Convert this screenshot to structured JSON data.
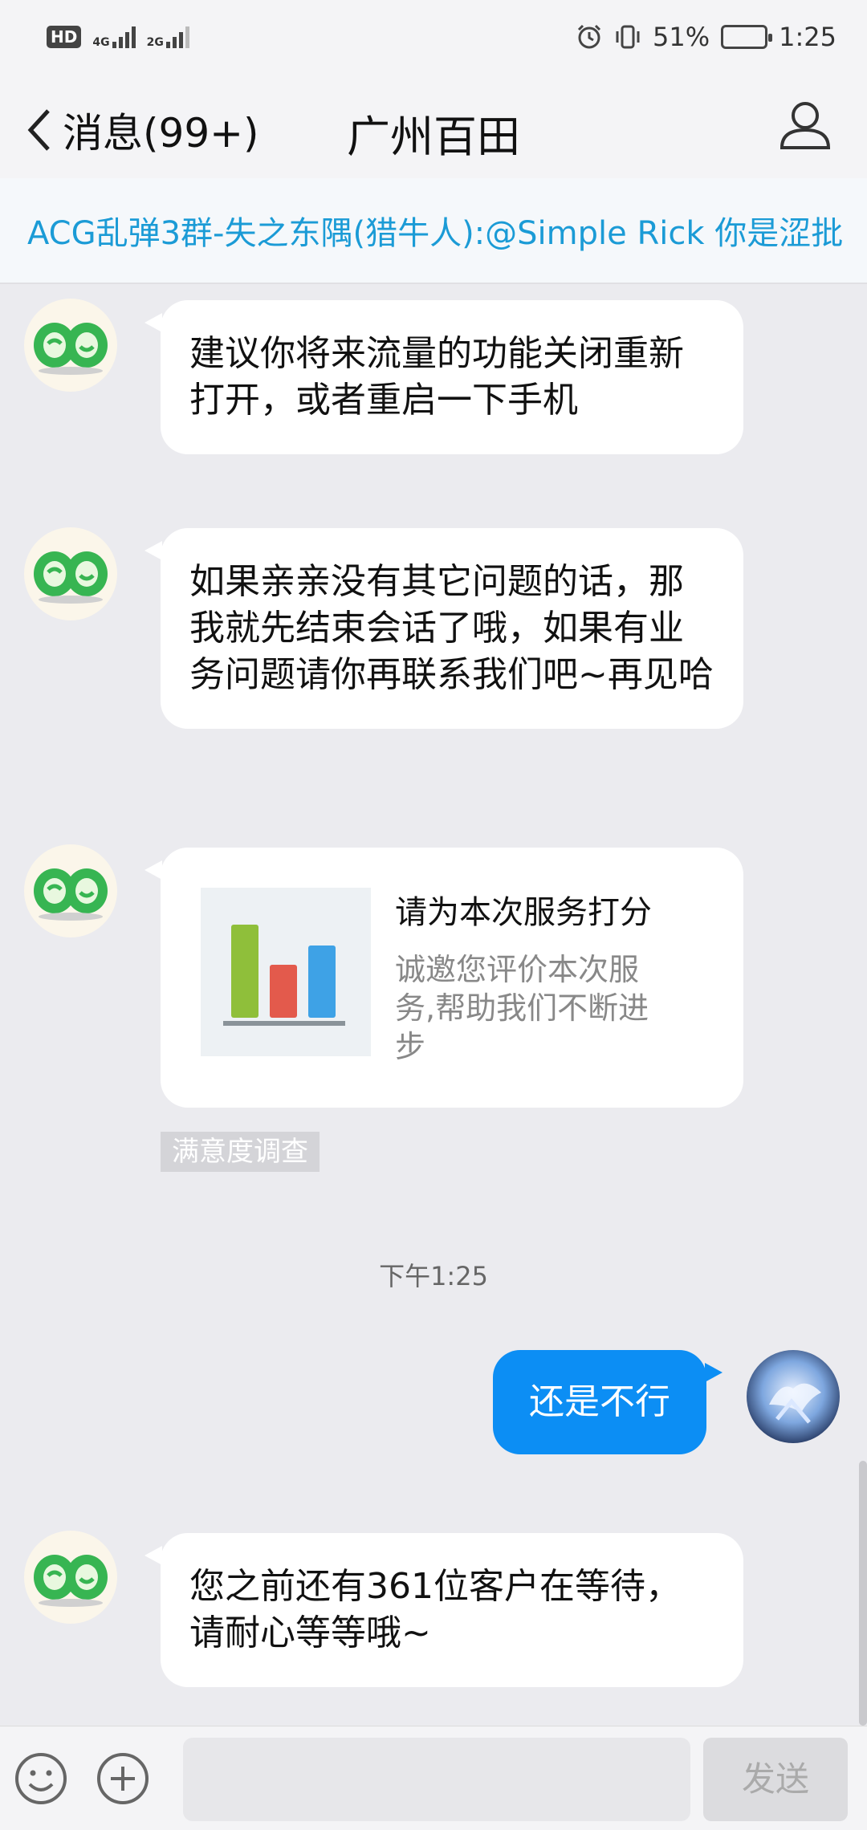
{
  "status_bar": {
    "hd": "HD",
    "net1": "4G",
    "net2": "2G",
    "battery_percent": "51%",
    "battery_level": 0.51,
    "time": "1:25"
  },
  "nav": {
    "back_label": "消息(99+)",
    "title": "广州百田"
  },
  "banner": {
    "text": "ACG乱弹3群-失之东隅(猎牛人):@Simple Rick 你是涩批"
  },
  "messages": [
    {
      "sender": "bot",
      "text": "建议你将来流量的功能关闭重新打开，或者重启一下手机"
    },
    {
      "sender": "bot",
      "text": "如果亲亲没有其它问题的话，那我就先结束会话了哦，如果有业务问题请你再联系我们吧~再见哈"
    },
    {
      "sender": "bot",
      "card": {
        "title": "请为本次服务打分",
        "description": "诚邀您评价本次服务,帮助我们不断进步"
      },
      "tag": "满意度调查"
    },
    {
      "sender": "me",
      "text": "还是不行"
    },
    {
      "sender": "bot",
      "text": "您之前还有361位客户在等待，请耐心等等哦~"
    }
  ],
  "time_separator": "下午1:25",
  "bottom": {
    "input_value": "",
    "send_label": "发送"
  },
  "colors": {
    "accent_blue": "#0c8ef4",
    "banner_text": "#1b9bd6",
    "background": "#ebebef"
  },
  "icons": [
    "back-chevron-icon",
    "profile-icon",
    "emoji-icon",
    "plus-icon",
    "bot-avatar-icon",
    "user-avatar-icon",
    "bar-chart-icon"
  ]
}
